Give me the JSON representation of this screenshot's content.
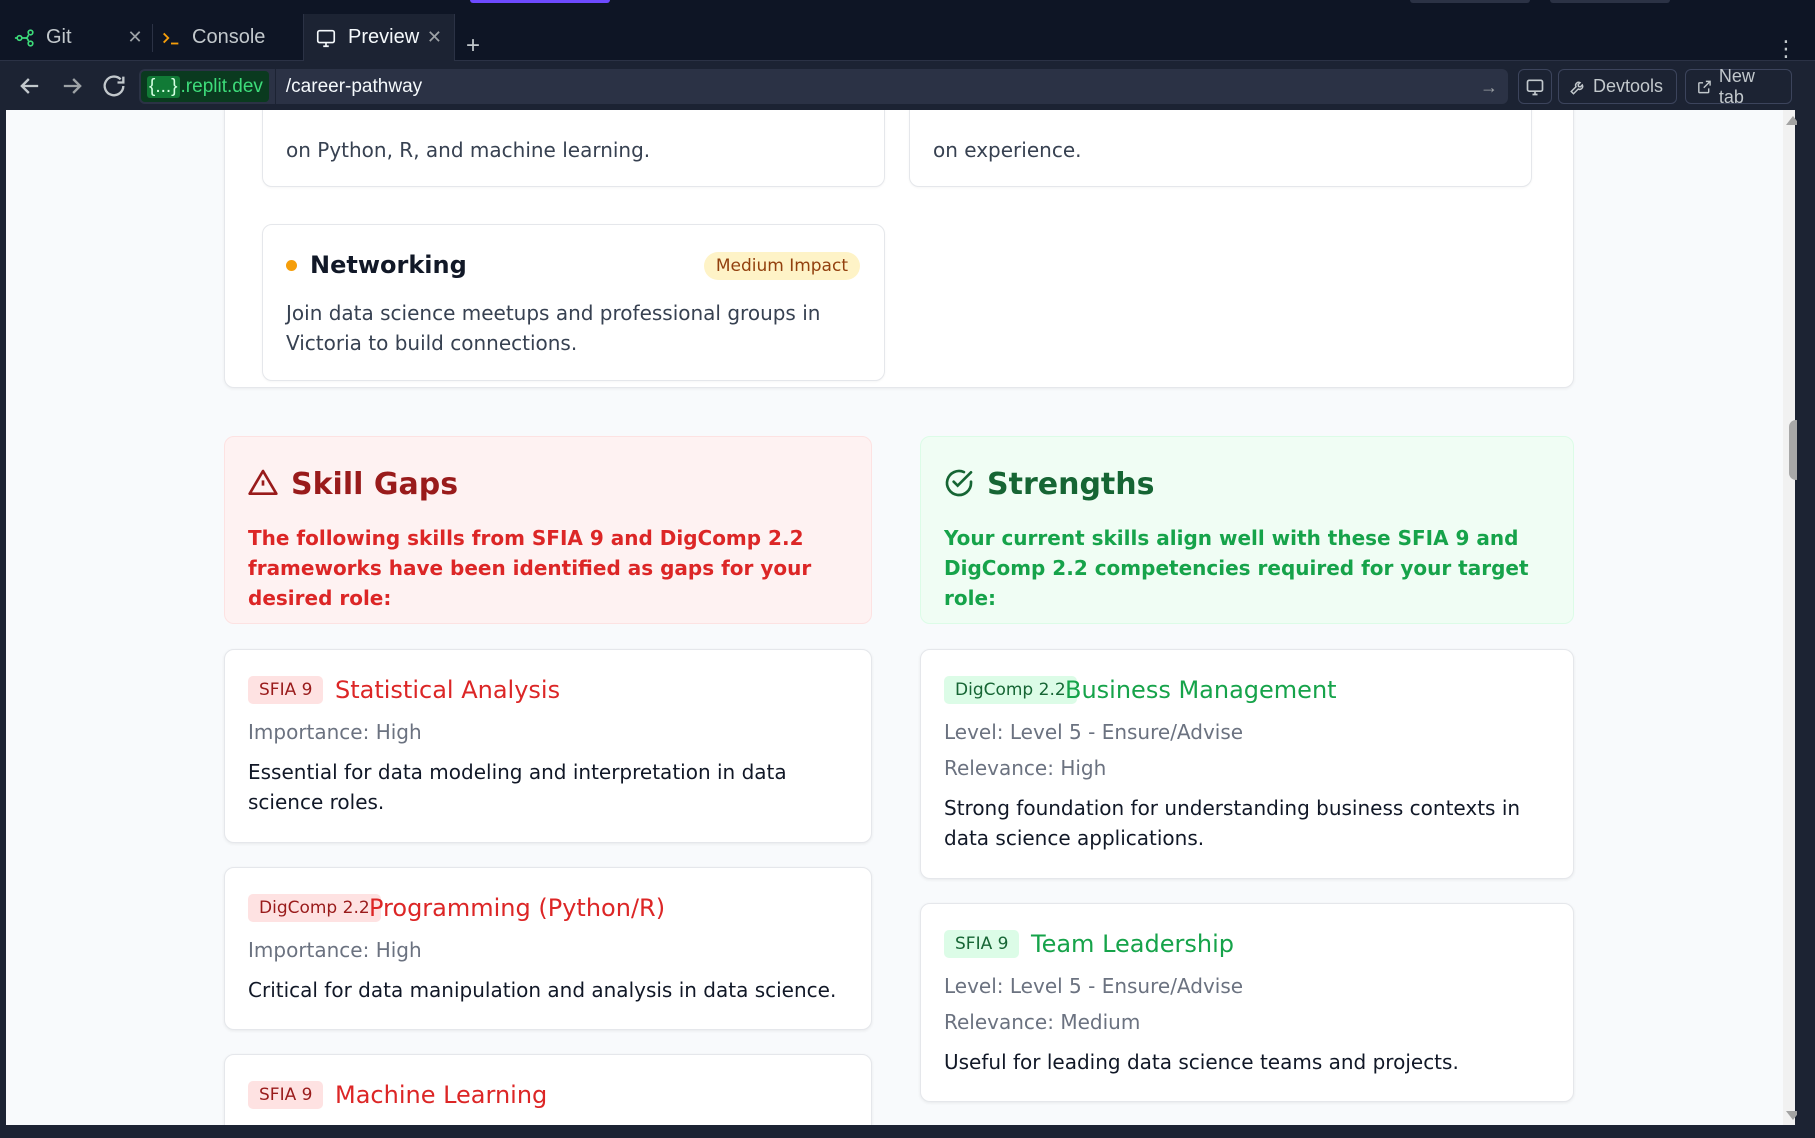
{
  "browser": {
    "tabs": [
      {
        "label": "Git",
        "icon": "git-icon"
      },
      {
        "label": "Console",
        "icon": "console-icon"
      },
      {
        "label": "Preview",
        "icon": "preview-icon"
      }
    ],
    "url_domain_prefix": "{...}",
    "url_domain": ".replit.dev",
    "url_path": "/career-pathway",
    "devtools_label": "Devtools",
    "newtab_label": "New tab"
  },
  "steps": {
    "left_partial_text": "on Python, R, and machine learning.",
    "right_partial_text": "on experience.",
    "networking": {
      "title": "Networking",
      "impact": "Medium Impact",
      "description": "Join data science meetups and professional groups in Victoria to build connections."
    }
  },
  "skill_gaps": {
    "title": "Skill Gaps",
    "description": "The following skills from SFIA 9 and DigComp 2.2 frameworks have been identified as gaps for your desired role:",
    "items": [
      {
        "framework": "SFIA 9",
        "name": "Statistical Analysis",
        "importance": "Importance: High",
        "description": "Essential for data modeling and interpretation in data science roles."
      },
      {
        "framework": "DigComp 2.2",
        "name": "Programming (Python/R)",
        "importance": "Importance: High",
        "description": "Critical for data manipulation and analysis in data science."
      },
      {
        "framework": "SFIA 9",
        "name": "Machine Learning"
      }
    ]
  },
  "strengths": {
    "title": "Strengths",
    "description": "Your current skills align well with these SFIA 9 and DigComp 2.2 competencies required for your target role:",
    "items": [
      {
        "framework": "DigComp 2.2",
        "name": "Business Management",
        "level": "Level: Level 5 - Ensure/Advise",
        "relevance": "Relevance: High",
        "description": "Strong foundation for understanding business contexts in data science applications."
      },
      {
        "framework": "SFIA 9",
        "name": "Team Leadership",
        "level": "Level: Level 5 - Ensure/Advise",
        "relevance": "Relevance: Medium",
        "description": "Useful for leading data science teams and projects."
      }
    ]
  },
  "colors": {
    "gap_accent": "#dc2626",
    "strength_accent": "#16a34a",
    "impact_medium": "#f59e0b"
  }
}
